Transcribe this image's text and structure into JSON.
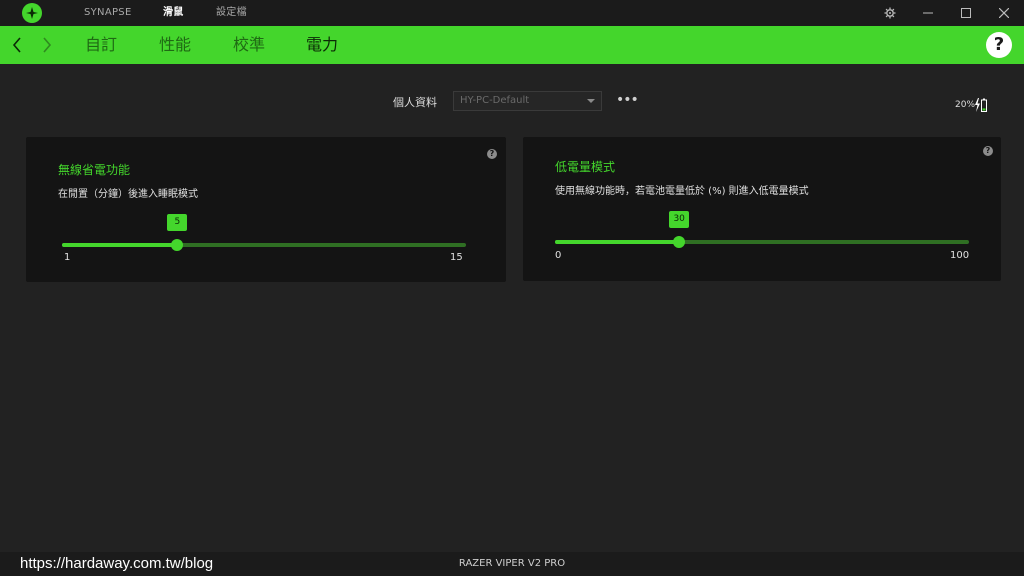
{
  "topbar": {
    "nav": [
      "SYNAPSE",
      "滑鼠",
      "設定檔"
    ],
    "active_index": 1
  },
  "tabs": [
    "自訂",
    "性能",
    "校準",
    "電力"
  ],
  "active_tab": 3,
  "help_label": "?",
  "profile": {
    "label": "個人資料",
    "value": "HY-PC-Default",
    "more": "•••"
  },
  "battery": {
    "text": "20%",
    "level": 0.2
  },
  "panels": {
    "sleep": {
      "title": "無線省電功能",
      "description": "在閒置（分鐘）後進入睡眠模式",
      "value": "5",
      "min": "1",
      "max": "15"
    },
    "low_power": {
      "title": "低電量模式",
      "description": "使用無線功能時，若電池電量低於 (%) 則進入低電量模式",
      "value": "30",
      "min": "0",
      "max": "100"
    }
  },
  "footer": {
    "watermark": "https://hardaway.com.tw/blog",
    "device": "RAZER VIPER V2 PRO"
  },
  "colors": {
    "accent": "#44d62c",
    "background": "#222222",
    "panel": "#141414"
  },
  "icons": [
    "razer-logo-icon",
    "gear-icon",
    "minimize-icon",
    "maximize-icon",
    "close-icon",
    "back-arrow-icon",
    "forward-arrow-icon",
    "help-icon",
    "battery-charging-icon",
    "dropdown-caret-icon",
    "more-icon"
  ]
}
